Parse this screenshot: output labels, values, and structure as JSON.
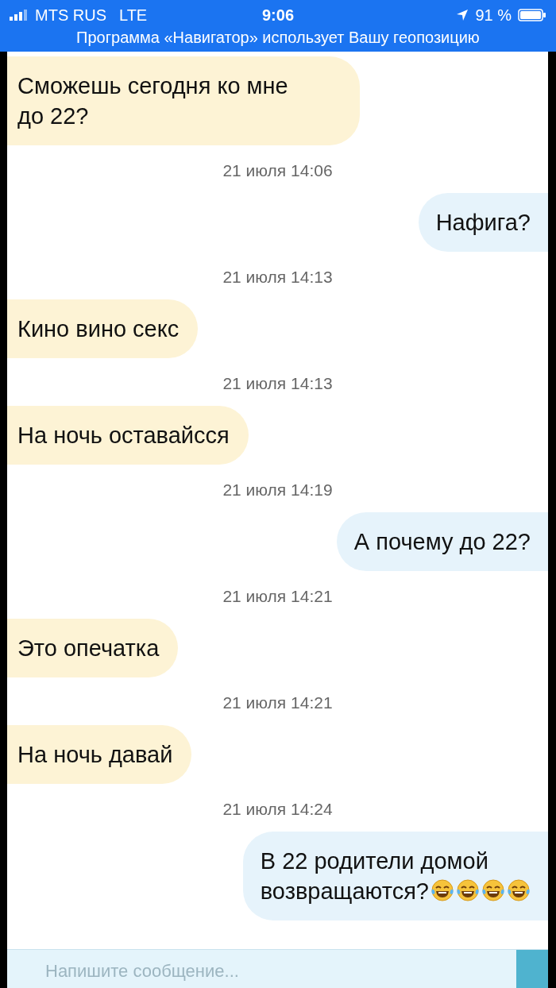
{
  "status_bar": {
    "carrier": "MTS RUS",
    "network": "LTE",
    "time": "9:06",
    "battery": "91 %"
  },
  "location_banner": "Программа «Навигатор» использует Вашу геопозицию",
  "messages": [
    {
      "kind": "incoming",
      "lines": [
        "Сможешь сегодня ко мне",
        "до 22?"
      ],
      "time": "21 июля 14:06"
    },
    {
      "kind": "outgoing",
      "lines": [
        "Нафига?"
      ],
      "time": "21 июля 14:13"
    },
    {
      "kind": "incoming",
      "lines": [
        "Кино вино секс"
      ],
      "time": "21 июля 14:13"
    },
    {
      "kind": "incoming",
      "lines": [
        "На ночь оставайсся"
      ],
      "time": "21 июля 14:19"
    },
    {
      "kind": "outgoing",
      "lines": [
        "А почему до 22?"
      ],
      "time": "21 июля 14:21"
    },
    {
      "kind": "incoming",
      "lines": [
        "Это опечатка"
      ],
      "time": "21 июля 14:21"
    },
    {
      "kind": "incoming",
      "lines": [
        "На ночь давай"
      ],
      "time": "21 июля 14:24"
    },
    {
      "kind": "outgoing",
      "lines": [
        "В 22 родители домой",
        "возвращаются?"
      ],
      "emoji_after": true
    }
  ],
  "composer": {
    "placeholder": "Напишите сообщение..."
  }
}
